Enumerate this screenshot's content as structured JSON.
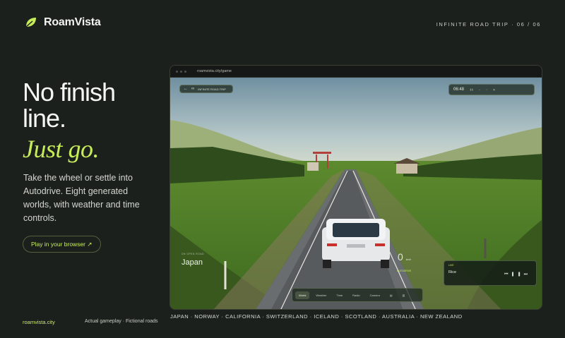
{
  "brand": {
    "name": "RoamVista",
    "logo_icon": "leaf-icon",
    "accent": "#c7ec5a"
  },
  "counter": "INFINITE ROAD TRIP · 06 / 06",
  "headline": "No finish line.",
  "tagline": "Just go.",
  "description": "Take the wheel or settle into Autodrive. Eight generated worlds, with weather and time controls.",
  "cta": "Play in your browser ↗",
  "footer": {
    "link": "roamvista.city",
    "note": "Actual gameplay · Fictional roads"
  },
  "worlds": "JAPAN · NORWAY · CALIFORNIA · SWITZERLAND · ICELAND · SCOTLAND · AUSTRALIA · NEW ZEALAND",
  "browser": {
    "url": "roamvista.city/game"
  },
  "game": {
    "trip_label": "INFINITE ROAD TRIP",
    "time": "06:48",
    "location_tag": "ON OPEN ROAD",
    "location": "Japan",
    "speed_value": "0",
    "speed_unit": "km/h",
    "drive_mode": "AUTODRIVE",
    "music_status": "LIVE",
    "track": "Rice",
    "tabs": [
      "World",
      "Weather",
      "Time",
      "Radio",
      "Camera"
    ]
  }
}
